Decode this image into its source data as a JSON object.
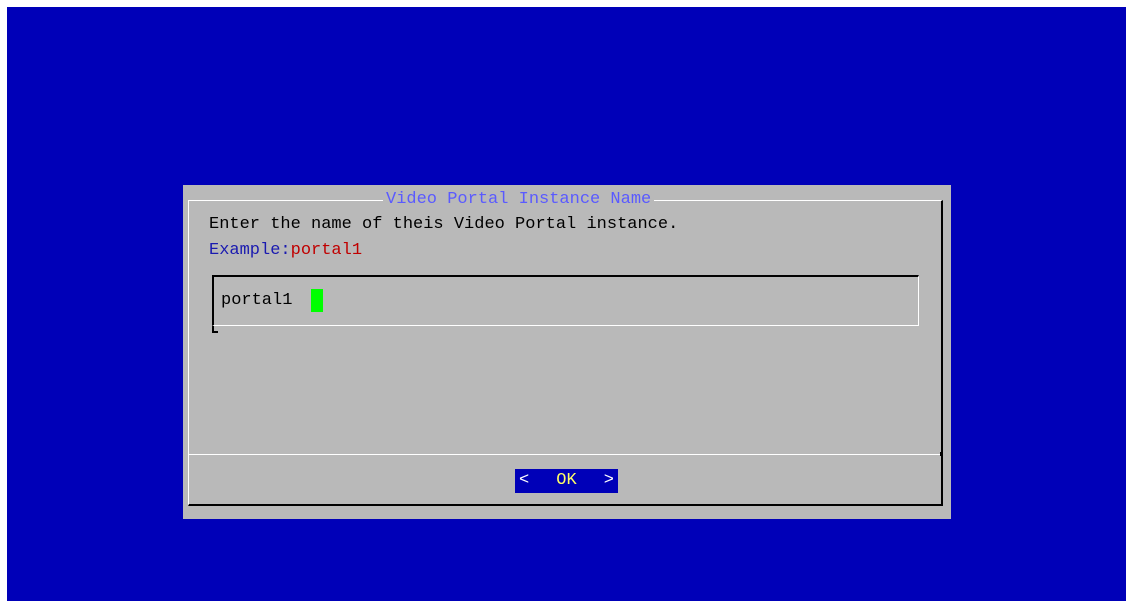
{
  "dialog": {
    "title": "Video Portal Instance Name",
    "prompt": "Enter the name of theis Video Portal instance.",
    "example_label": "Example:",
    "example_value": "portal1"
  },
  "input": {
    "value": "portal1"
  },
  "buttons": {
    "ok_left_bracket": "<",
    "ok_label": "OK",
    "ok_right_bracket": ">"
  },
  "colors": {
    "background": "#0000b8",
    "dialog": "#b9b9b9",
    "title": "#5a5aff",
    "example_label": "#1a1ab0",
    "example_value": "#c00000",
    "cursor": "#00ff00",
    "ok_label": "#ffff66"
  }
}
